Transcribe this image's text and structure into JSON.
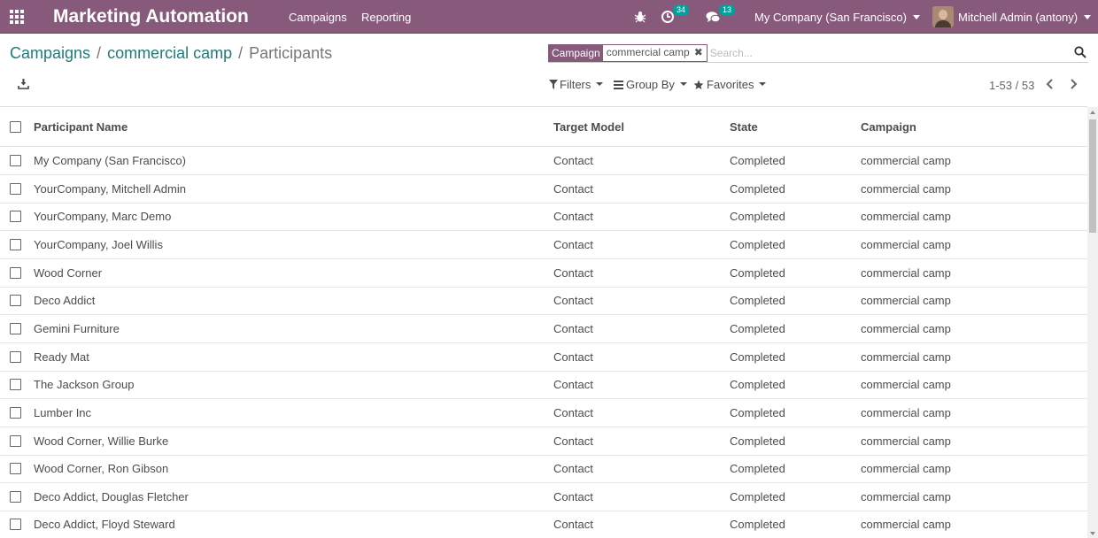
{
  "navbar": {
    "app_title": "Marketing Automation",
    "menu": [
      "Campaigns",
      "Reporting"
    ],
    "activity_count": "34",
    "message_count": "13",
    "company": "My Company (San Francisco)",
    "user": "Mitchell Admin (antony)",
    "icons": [
      "apps-grid-icon",
      "bug-icon",
      "clock-icon",
      "chat-icon"
    ]
  },
  "breadcrumb": {
    "items": [
      "Campaigns",
      "commercial camp"
    ],
    "separator": "/",
    "current": "Participants"
  },
  "search": {
    "facet_label": "Campaign",
    "facet_value": "commercial camp",
    "placeholder": "Search..."
  },
  "filters": {
    "filters_label": "Filters",
    "group_by_label": "Group By",
    "favorites_label": "Favorites"
  },
  "pager": {
    "value": "1-53 / 53"
  },
  "table": {
    "columns": [
      "Participant Name",
      "Target Model",
      "State",
      "Campaign"
    ],
    "rows": [
      [
        "My Company (San Francisco)",
        "Contact",
        "Completed",
        "commercial camp"
      ],
      [
        "YourCompany, Mitchell Admin",
        "Contact",
        "Completed",
        "commercial camp"
      ],
      [
        "YourCompany, Marc Demo",
        "Contact",
        "Completed",
        "commercial camp"
      ],
      [
        "YourCompany, Joel Willis",
        "Contact",
        "Completed",
        "commercial camp"
      ],
      [
        "Wood Corner",
        "Contact",
        "Completed",
        "commercial camp"
      ],
      [
        "Deco Addict",
        "Contact",
        "Completed",
        "commercial camp"
      ],
      [
        "Gemini Furniture",
        "Contact",
        "Completed",
        "commercial camp"
      ],
      [
        "Ready Mat",
        "Contact",
        "Completed",
        "commercial camp"
      ],
      [
        "The Jackson Group",
        "Contact",
        "Completed",
        "commercial camp"
      ],
      [
        "Lumber Inc",
        "Contact",
        "Completed",
        "commercial camp"
      ],
      [
        "Wood Corner, Willie Burke",
        "Contact",
        "Completed",
        "commercial camp"
      ],
      [
        "Wood Corner, Ron Gibson",
        "Contact",
        "Completed",
        "commercial camp"
      ],
      [
        "Deco Addict, Douglas Fletcher",
        "Contact",
        "Completed",
        "commercial camp"
      ],
      [
        "Deco Addict, Floyd Steward",
        "Contact",
        "Completed",
        "commercial camp"
      ]
    ]
  },
  "colors": {
    "navbar": "#875a7b",
    "link": "#1d7c7a",
    "badge": "#00a09d"
  }
}
